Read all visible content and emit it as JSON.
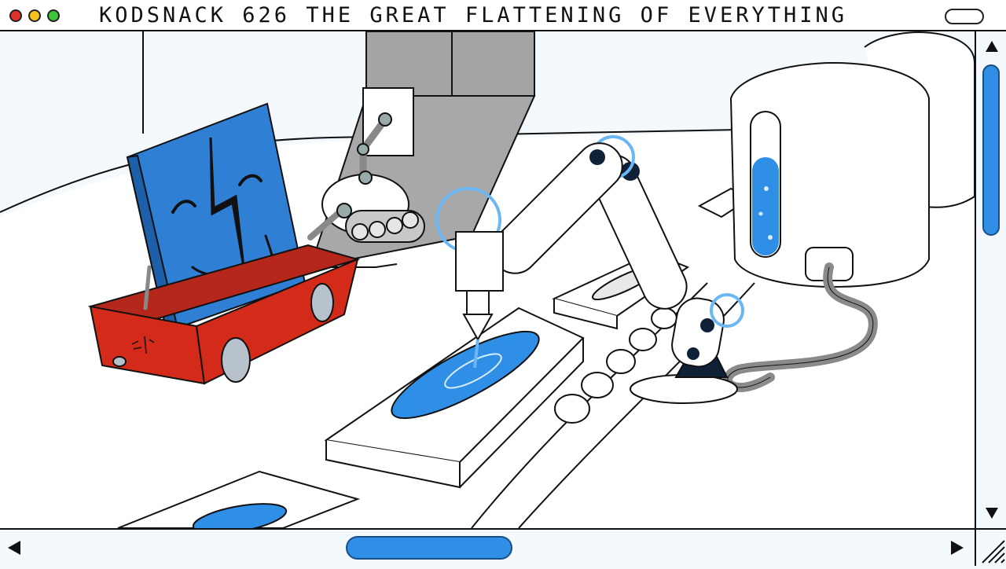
{
  "window": {
    "title": "KODSNACK 626  THE GREAT FLATTENING OF EVERYTHING"
  },
  "colors": {
    "close": "#e0322a",
    "minimize": "#f4c21b",
    "zoom": "#3cc43a",
    "accent_blue": "#2f8fe6",
    "cart_red": "#d42a1a"
  },
  "icons": {
    "close": "close-light",
    "minimize": "minimize-light",
    "zoom": "zoom-light",
    "scroll_up": "triangle-up",
    "scroll_down": "triangle-down",
    "scroll_left": "triangle-left",
    "scroll_right": "triangle-right",
    "resize": "diagonal-lines"
  },
  "scrollbars": {
    "vertical_position": 0.05,
    "horizontal_position": 0.45
  }
}
